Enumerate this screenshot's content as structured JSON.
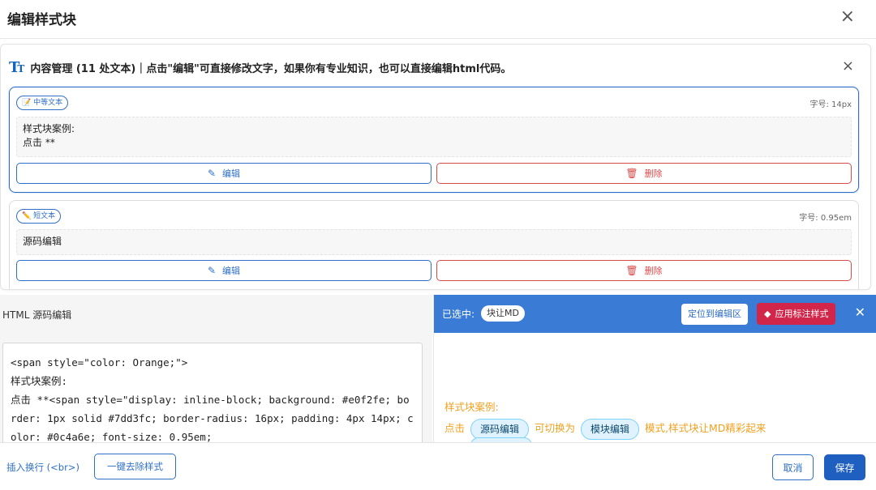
{
  "dialog": {
    "title": "编辑样式块",
    "close_icon": "×"
  },
  "content_manager": {
    "icon": "text-size-icon",
    "title": "内容管理 (11 处文本)｜点击\"编辑\"可直接修改文字，如果你有专业知识，也可以直接编辑html代码。",
    "close_icon": "×",
    "blocks": [
      {
        "tag": "📝 中等文本",
        "font_size": "字号: 14px",
        "text_lines": [
          "样式块案例:",
          "点击 **"
        ],
        "edit_label": "编辑",
        "delete_label": "删除"
      },
      {
        "tag": "✏️ 短文本",
        "font_size": "字号: 0.95em",
        "text_lines": [
          "源码编辑"
        ],
        "edit_label": "编辑",
        "delete_label": "删除"
      }
    ]
  },
  "source_editor": {
    "title": "HTML 源码编辑",
    "code": "<span style=\"color: Orange;\">\n样式块案例:\n点击 **<span style=\"display: inline-block; background: #e0f2fe; border: 1px solid #7dd3fc; border-radius: 16px; padding: 4px 14px; color: #0c4a6e; font-size: 0.95em;"
  },
  "preview": {
    "selected_label": "已选中:",
    "selected_chip": "块让MD",
    "locate_button": "定位到编辑区",
    "apply_button": "应用标注样式",
    "apply_icon": "eraser-icon",
    "close_icon": "✕",
    "line1": "样式块案例:",
    "line2_prefix": "点击",
    "chip1": "源码编辑",
    "line2_mid": "可切换为",
    "chip2": "模块编辑",
    "line2_suffix": "模式,样式块让MD精彩起来",
    "colors": {
      "text": "#f0a020",
      "chip_bg": "#e0f2fe",
      "chip_border": "#7dd3fc",
      "chip_text": "#0c4a6e",
      "bar": "#3a7bd5"
    }
  },
  "footer": {
    "insert_br": "插入换行 (<br>)",
    "remove_style": "一键去除样式",
    "cancel": "取消",
    "save": "保存"
  }
}
